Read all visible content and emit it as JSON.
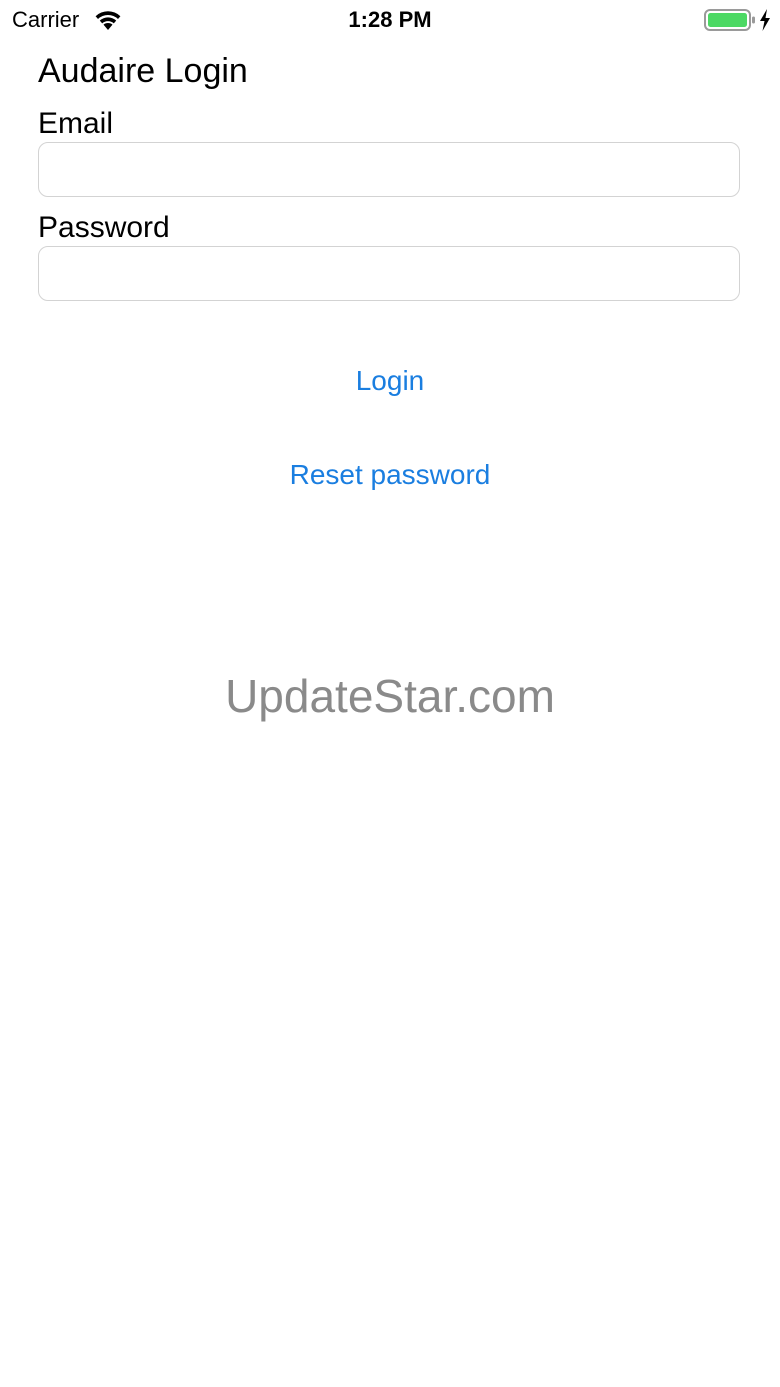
{
  "status_bar": {
    "carrier": "Carrier",
    "time": "1:28 PM",
    "battery_color": "#4cd964"
  },
  "login": {
    "title": "Audaire Login",
    "email_label": "Email",
    "email_value": "",
    "password_label": "Password",
    "password_value": "",
    "login_button": "Login",
    "reset_password_button": "Reset password"
  },
  "watermark": {
    "text": "UpdateStar.com"
  },
  "colors": {
    "link": "#1a7ee0",
    "field_border": "#d3d3d3",
    "watermark": "#8a8a8a"
  }
}
